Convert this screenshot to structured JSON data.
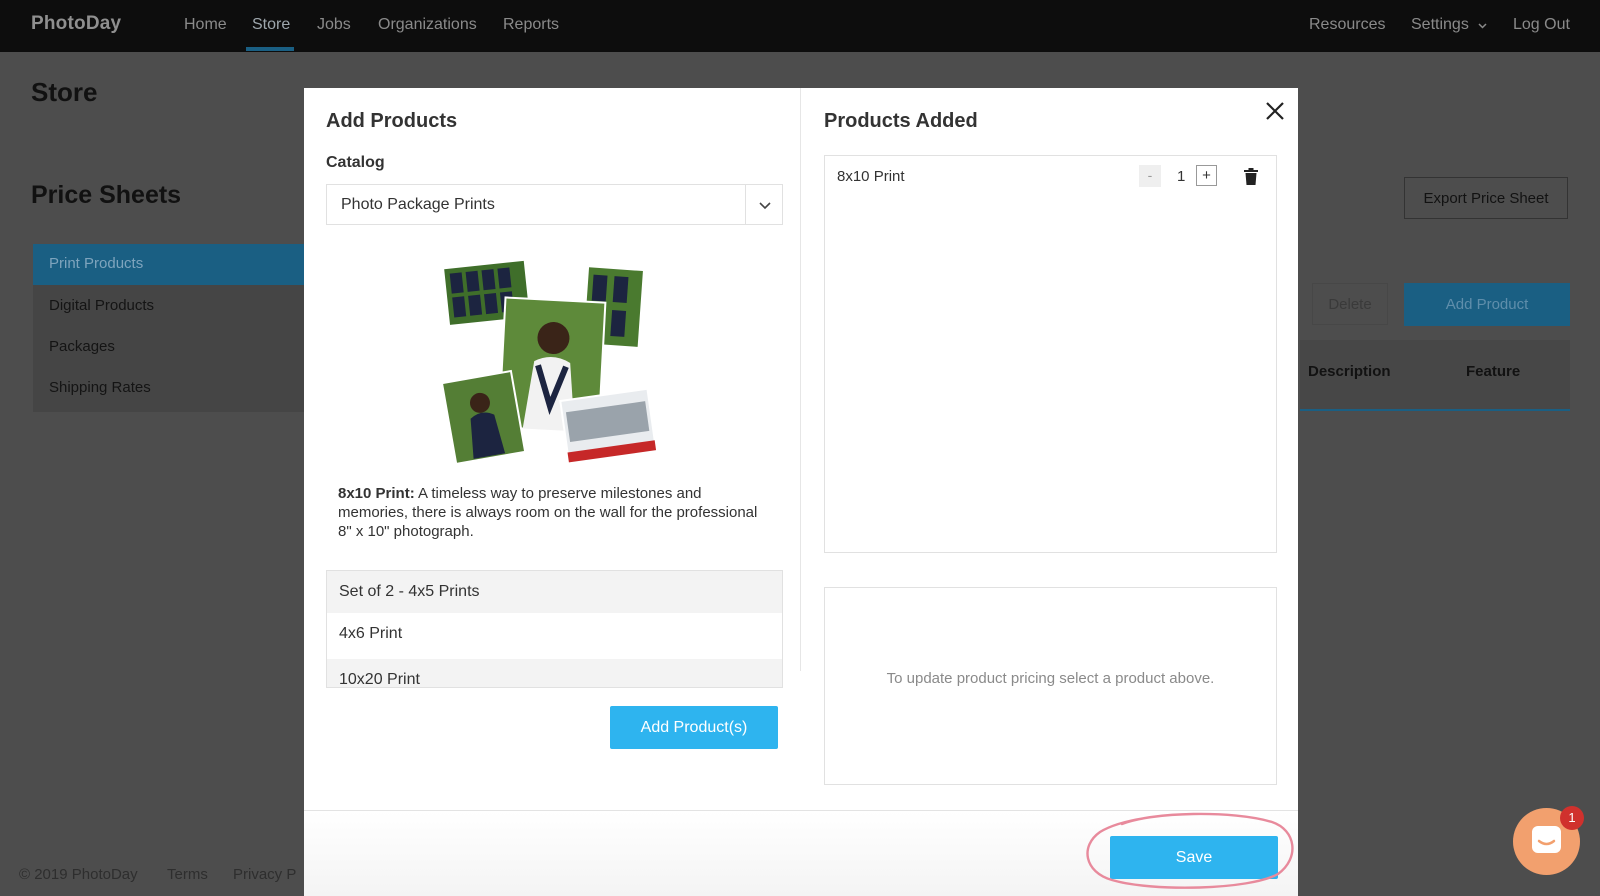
{
  "app": {
    "logo": "PhotoDay"
  },
  "nav": {
    "left": [
      "Home",
      "Store",
      "Jobs",
      "Organizations",
      "Reports"
    ],
    "active": "Store",
    "right": {
      "resources": "Resources",
      "settings": "Settings",
      "logout": "Log Out"
    }
  },
  "page": {
    "title": "Store",
    "section_title": "Price Sheets",
    "sidebar": [
      {
        "label": "Print Products",
        "active": true
      },
      {
        "label": "Digital Products",
        "active": false
      },
      {
        "label": "Packages",
        "active": false
      },
      {
        "label": "Shipping Rates",
        "active": false
      }
    ],
    "export_button": "Export Price Sheet",
    "delete_button": "Delete",
    "add_product_button": "Add Product",
    "table_headers": [
      "Description",
      "Feature"
    ],
    "footer": {
      "copyright": "© 2019 PhotoDay",
      "terms": "Terms",
      "privacy": "Privacy P"
    }
  },
  "modal": {
    "left_title": "Add Products",
    "catalog_label": "Catalog",
    "catalog_value": "Photo Package Prints",
    "product_desc_name": "8x10 Print:",
    "product_desc_text": "A timeless way to preserve milestones and memories, there is always room on the wall for the professional 8\" x 10\" photograph.",
    "product_list": [
      "Set of 2 - 4x5 Prints",
      "4x6 Print",
      "10x20 Print"
    ],
    "add_products_button": "Add Product(s)",
    "right_title": "Products Added",
    "added": [
      {
        "name": "8x10 Print",
        "qty": "1",
        "minus": "-",
        "plus": "+"
      }
    ],
    "pricing_hint": "To update product pricing select a product above.",
    "save_button": "Save"
  },
  "chat": {
    "badge": "1"
  },
  "colors": {
    "accent": "#2eb4ef",
    "nav_bg": "#0d0d0d",
    "annotation": "#e88a9c"
  }
}
